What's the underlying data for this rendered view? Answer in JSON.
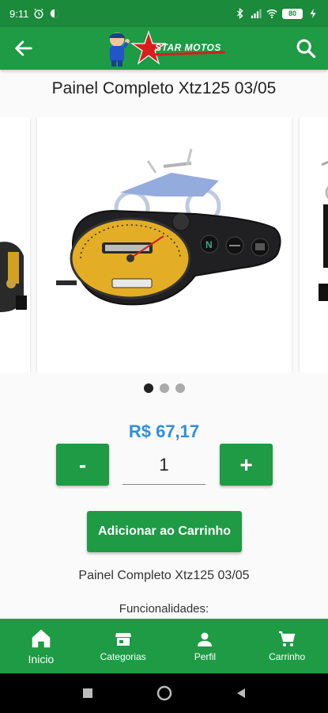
{
  "status_bar": {
    "time": "9:11",
    "battery": "80"
  },
  "app_bar": {
    "brand": "STAR MOTOS",
    "back_icon": "arrow-left-icon",
    "search_icon": "search-icon"
  },
  "product": {
    "title": "Painel Completo Xtz125 03/05",
    "price": "R$ 67,17",
    "quantity": "1",
    "minus_label": "-",
    "plus_label": "+",
    "add_to_cart_label": "Adicionar ao Carrinho",
    "description": "Painel Completo Xtz125 03/05",
    "features_label": "Funcionalidades:"
  },
  "carousel": {
    "slide_count": 3,
    "active_index": 0
  },
  "bottom_nav": [
    {
      "label": "Inicio",
      "icon": "home-icon",
      "active": true
    },
    {
      "label": "Categorias",
      "icon": "store-icon",
      "active": false
    },
    {
      "label": "Perfil",
      "icon": "person-icon",
      "active": false
    },
    {
      "label": "Carrinho",
      "icon": "cart-icon",
      "active": false
    }
  ],
  "colors": {
    "primary": "#1f9a45",
    "price": "#2f8ee0",
    "status_bar": "#1b8a3a"
  }
}
